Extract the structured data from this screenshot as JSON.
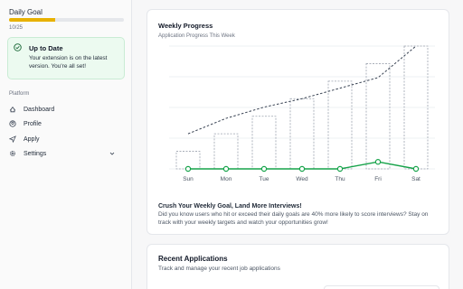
{
  "sidebar": {
    "daily_goal": {
      "label": "Daily Goal",
      "count_text": "10/25",
      "progress": 0.4
    },
    "update_card": {
      "title": "Up to Date",
      "message": "Your extension is on the latest version. You're all set!"
    },
    "section_label": "Platform",
    "nav": [
      {
        "label": "Dashboard",
        "icon": "dashboard-icon"
      },
      {
        "label": "Profile",
        "icon": "profile-icon"
      },
      {
        "label": "Apply",
        "icon": "send-icon"
      },
      {
        "label": "Settings",
        "icon": "gear-icon",
        "has_chevron": true
      }
    ]
  },
  "weekly": {
    "title": "Weekly Progress",
    "subtitle": "Application Progress This Week",
    "tip_title": "Crush Your Weekly Goal, Land More Interviews!",
    "tip_text": "Did you know users who hit or exceed their daily goals are 40% more likely to score interviews? Stay on track with your weekly targets and watch your opportunities grow!"
  },
  "chart_data": {
    "type": "bar",
    "categories": [
      "Sun",
      "Mon",
      "Tue",
      "Wed",
      "Thu",
      "Fri",
      "Sat"
    ],
    "ylim": [
      0,
      175
    ],
    "series": [
      {
        "kind": "bar",
        "style": "dashed-outline",
        "values": [
          25,
          50,
          75,
          100,
          125,
          150,
          175
        ]
      },
      {
        "kind": "line",
        "style": "dashed",
        "values": [
          50,
          72,
          88,
          100,
          115,
          130,
          175
        ]
      },
      {
        "kind": "line",
        "style": "solid-markers",
        "color": "#16a34a",
        "values": [
          0,
          0,
          0,
          0,
          0,
          10,
          0
        ]
      }
    ],
    "grid": true,
    "colors": {
      "bar_outline": "#9ca3af",
      "trend": "#374151",
      "actual": "#16a34a"
    }
  },
  "recent": {
    "title": "Recent Applications",
    "subtitle": "Track and manage your recent job applications"
  }
}
